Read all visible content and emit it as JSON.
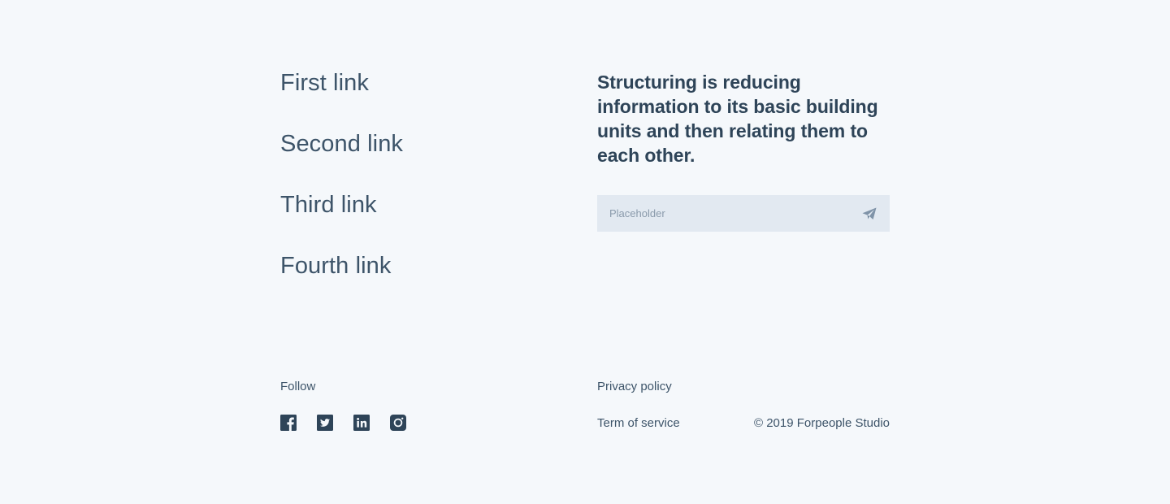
{
  "nav": {
    "links": [
      {
        "label": "First link"
      },
      {
        "label": "Second link"
      },
      {
        "label": "Third link"
      },
      {
        "label": "Fourth link"
      }
    ]
  },
  "headline": "Structuring is reducing information to its basic building units and then relating them to each other.",
  "subscribe": {
    "placeholder": "Placeholder",
    "value": "",
    "send_icon": "paper-plane-icon"
  },
  "follow": {
    "label": "Follow",
    "icons": [
      "facebook-icon",
      "twitter-icon",
      "linkedin-icon",
      "instagram-icon"
    ]
  },
  "legal": {
    "privacy": "Privacy policy",
    "terms": "Term of service"
  },
  "copyright": "© 2019 Forpeople Studio",
  "colors": {
    "background": "#f5f8fb",
    "text": "#354a5f",
    "input_bg": "#e2e9f1",
    "icon": "#2e4458",
    "send_icon": "#7f93a8"
  }
}
